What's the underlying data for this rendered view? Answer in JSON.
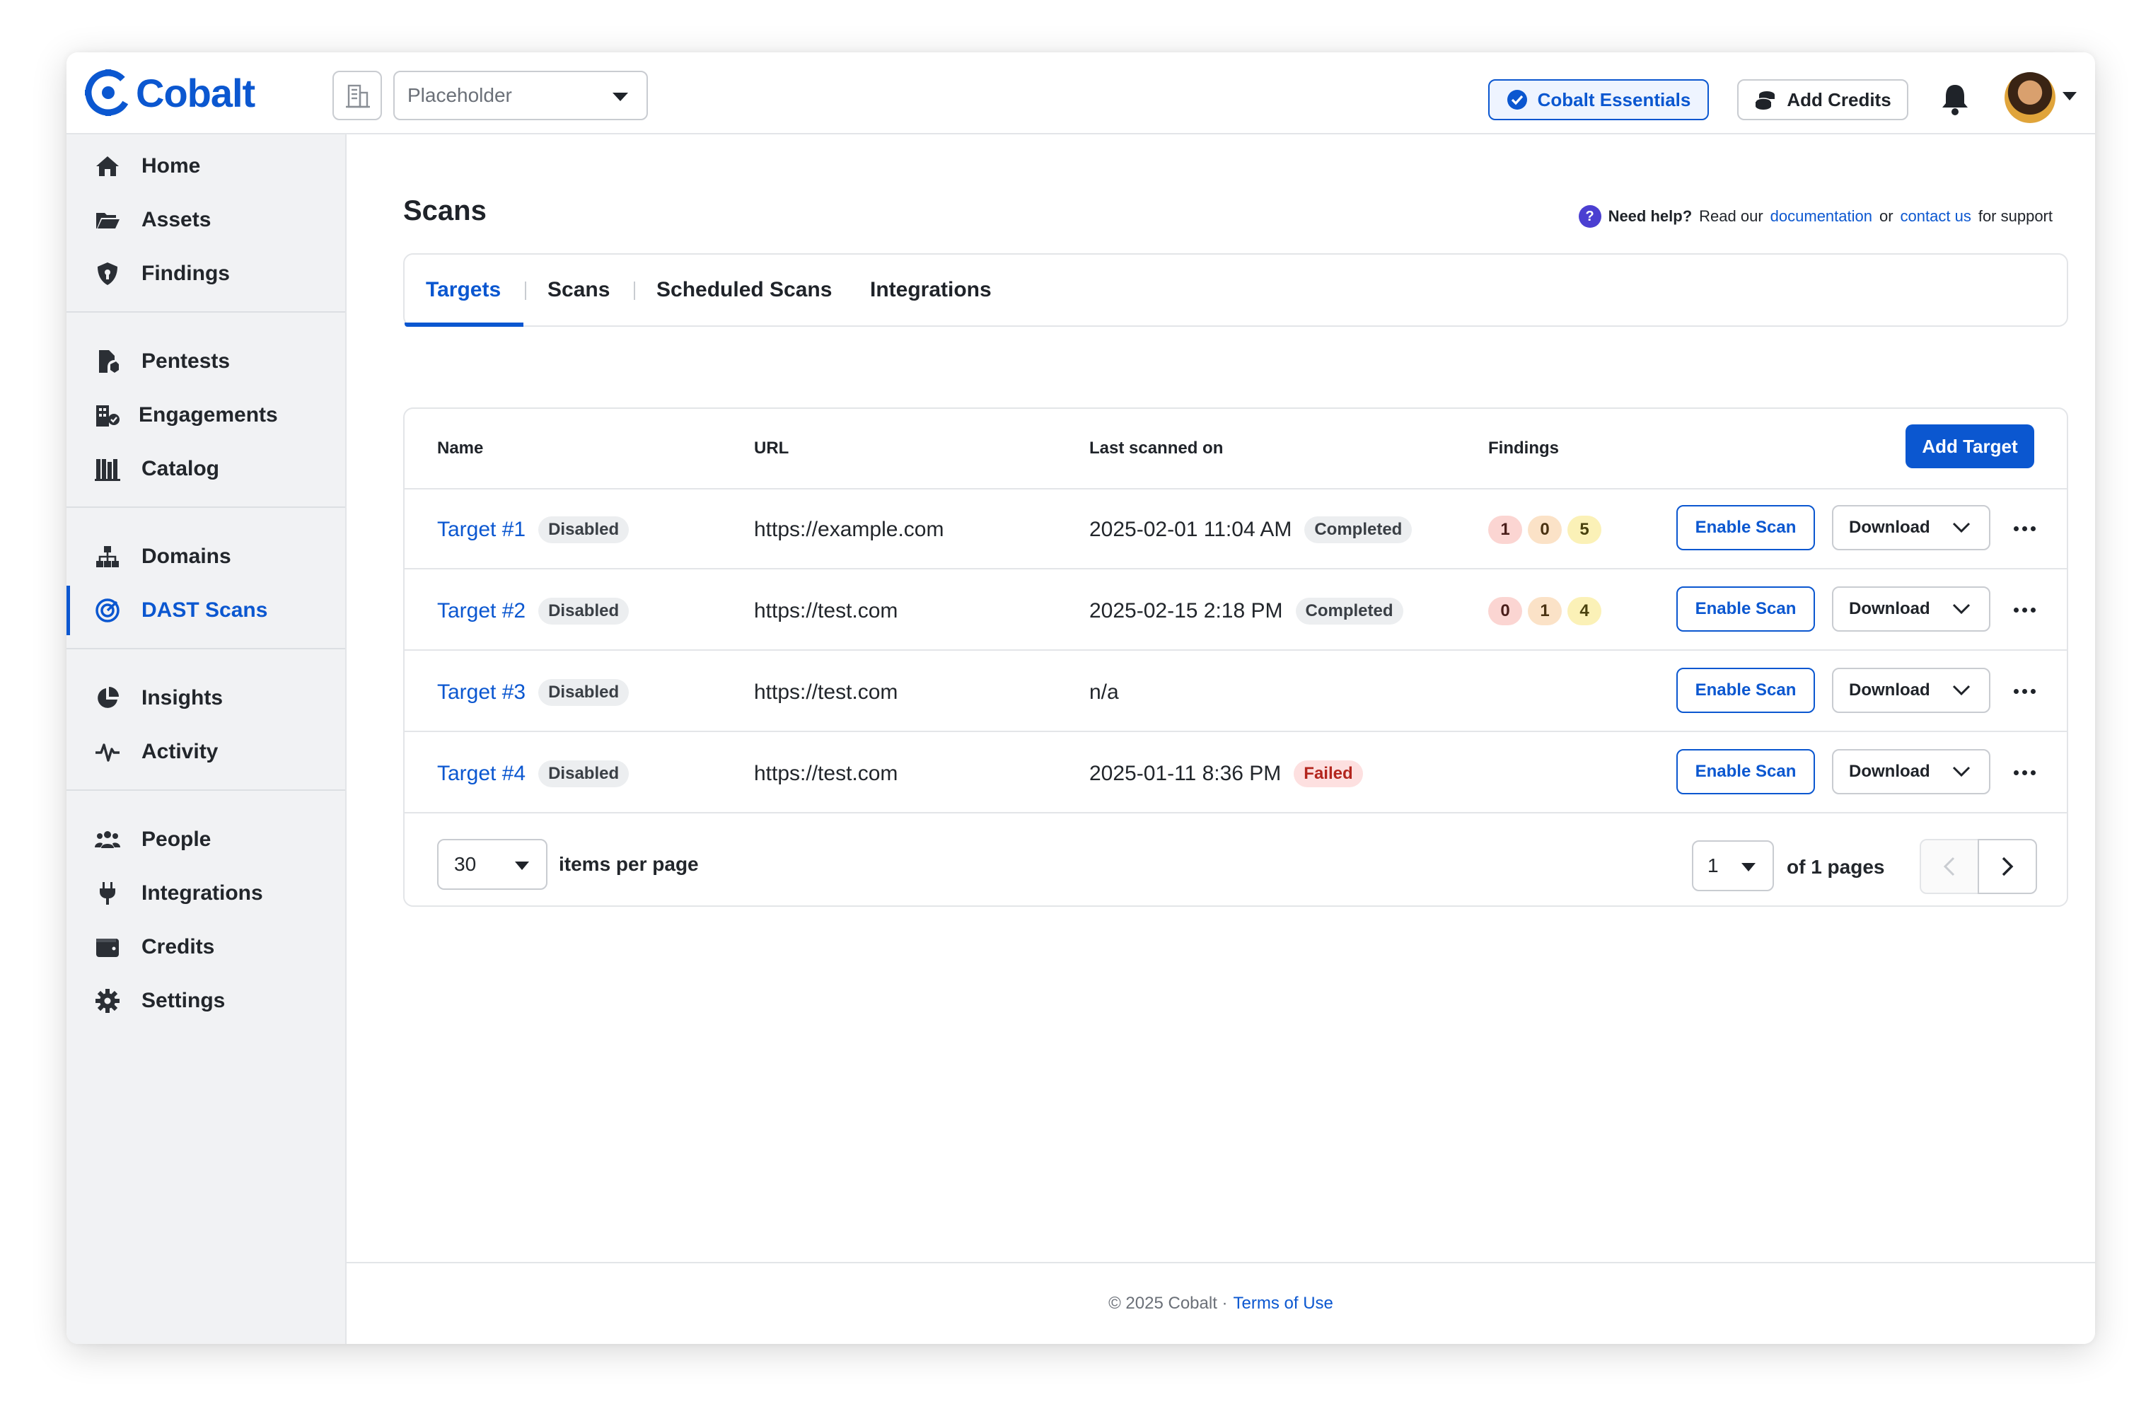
{
  "brand": {
    "name": "Cobalt",
    "accent": "#0b57d0"
  },
  "topbar": {
    "org_placeholder": "Placeholder",
    "essentials_label": "Cobalt Essentials",
    "add_credits_label": "Add Credits"
  },
  "sidebar": {
    "groups": [
      [
        {
          "label": "Home",
          "icon": "home-icon"
        },
        {
          "label": "Assets",
          "icon": "folder-icon"
        },
        {
          "label": "Findings",
          "icon": "shield-icon"
        }
      ],
      [
        {
          "label": "Pentests",
          "icon": "pentest-icon"
        },
        {
          "label": "Engagements",
          "icon": "engagements-icon"
        },
        {
          "label": "Catalog",
          "icon": "catalog-icon"
        }
      ],
      [
        {
          "label": "Domains",
          "icon": "sitemap-icon"
        },
        {
          "label": "DAST Scans",
          "icon": "radar-icon",
          "active": true
        }
      ],
      [
        {
          "label": "Insights",
          "icon": "pie-chart-icon"
        },
        {
          "label": "Activity",
          "icon": "pulse-icon"
        }
      ],
      [
        {
          "label": "People",
          "icon": "people-icon"
        },
        {
          "label": "Integrations",
          "icon": "plug-icon"
        },
        {
          "label": "Credits",
          "icon": "wallet-icon"
        },
        {
          "label": "Settings",
          "icon": "gear-icon"
        }
      ]
    ]
  },
  "page": {
    "title": "Scans",
    "help": {
      "strong": "Need help?",
      "pre": "Read our",
      "doc_link": "documentation",
      "mid": "or",
      "contact_link": "contact us",
      "post": "for support"
    }
  },
  "tabs": [
    "Targets",
    "Scans",
    "Scheduled Scans",
    "Integrations"
  ],
  "table": {
    "headers": {
      "name": "Name",
      "url": "URL",
      "last_scanned": "Last scanned on",
      "findings": "Findings"
    },
    "add_target_label": "Add Target",
    "enable_label": "Enable Scan",
    "download_label": "Download",
    "rows": [
      {
        "name": "Target #1",
        "state": "Disabled",
        "url": "https://example.com",
        "last": "2025-02-01 11:04 AM",
        "status": "Completed",
        "status_kind": "completed",
        "findings": [
          1,
          0,
          5
        ]
      },
      {
        "name": "Target #2",
        "state": "Disabled",
        "url": "https://test.com",
        "last": "2025-02-15 2:18 PM",
        "status": "Completed",
        "status_kind": "completed",
        "findings": [
          0,
          1,
          4
        ]
      },
      {
        "name": "Target #3",
        "state": "Disabled",
        "url": "https://test.com",
        "last": "n/a",
        "status": "",
        "status_kind": "",
        "findings": []
      },
      {
        "name": "Target #4",
        "state": "Disabled",
        "url": "https://test.com",
        "last": "2025-01-11 8:36 PM",
        "status": "Failed",
        "status_kind": "failed",
        "findings": []
      }
    ]
  },
  "pagination": {
    "per_page": "30",
    "per_page_label": "items per page",
    "page": "1",
    "of_pages": "of 1 pages"
  },
  "footer": {
    "copyright": "© 2025 Cobalt ·",
    "terms": "Terms of Use"
  }
}
